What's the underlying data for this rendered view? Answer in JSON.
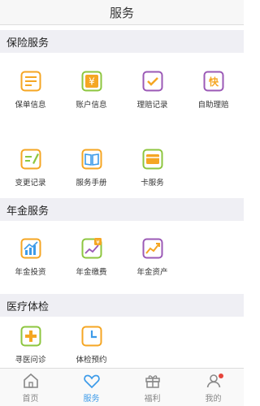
{
  "header": {
    "title": "服务"
  },
  "sections": {
    "insurance": {
      "title": "保险服务",
      "items": [
        {
          "label": "保单信息",
          "icon": "policy-doc-icon",
          "color": "#f5a623"
        },
        {
          "label": "账户信息",
          "icon": "account-yen-icon",
          "color": "#8dc63f"
        },
        {
          "label": "理赔记录",
          "icon": "claim-check-icon",
          "color": "#9b59b6"
        },
        {
          "label": "自助理赔",
          "icon": "quick-claim-icon",
          "color": "#9b59b6"
        },
        {
          "label": "变更记录",
          "icon": "change-record-icon",
          "color": "#f5a623"
        },
        {
          "label": "服务手册",
          "icon": "manual-book-icon",
          "color": "#f5a623"
        },
        {
          "label": "卡服务",
          "icon": "card-icon",
          "color": "#8dc63f"
        }
      ]
    },
    "pension": {
      "title": "年金服务",
      "items": [
        {
          "label": "年金投资",
          "icon": "investment-chart-icon",
          "color": "#f5a623"
        },
        {
          "label": "年金缴费",
          "icon": "payment-chart-icon",
          "color": "#8dc63f"
        },
        {
          "label": "年金资产",
          "icon": "asset-chart-icon",
          "color": "#9b59b6"
        }
      ]
    },
    "medical": {
      "title": "医疗体检",
      "items": [
        {
          "label": "寻医问诊",
          "icon": "medical-cross-icon",
          "color": "#8dc63f"
        },
        {
          "label": "体检预约",
          "icon": "checkup-clock-icon",
          "color": "#f5a623"
        }
      ]
    }
  },
  "tabbar": {
    "home": "首页",
    "service": "服务",
    "welfare": "福利",
    "mine": "我的",
    "active_color": "#3d9be9",
    "inactive_color": "#888888"
  }
}
